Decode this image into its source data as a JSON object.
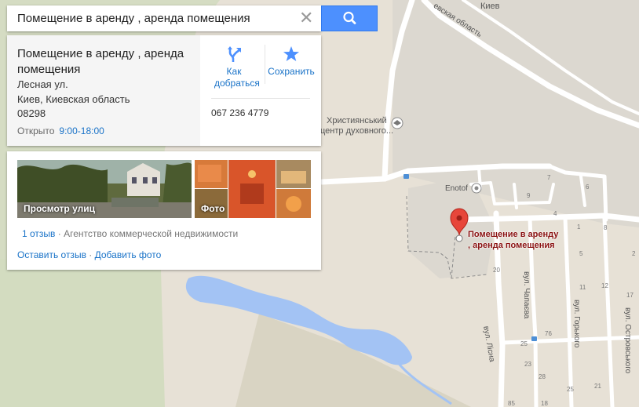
{
  "search": {
    "query": "Помещение в аренду , аренда помещения"
  },
  "place": {
    "name": "Помещение в аренду , аренда помещения",
    "street": "Лесная ул.",
    "city": "Киев, Киевская область",
    "postcode": "08298",
    "status": "Открыто",
    "hours": "9:00-18:00",
    "phone": "067 236 4779"
  },
  "actions": {
    "directions": "Как добраться",
    "save": "Сохранить"
  },
  "photos": {
    "street_view": "Просмотр улиц",
    "photo": "Фото"
  },
  "reviews": {
    "count": "1 отзыв",
    "category": "· Агентство коммерческой недвижимости"
  },
  "links": {
    "write_review": "Оставить отзыв",
    "separator": "·",
    "add_photo": "Добавить фото"
  },
  "map": {
    "region_label": "евская область",
    "city_label": "Киев",
    "poi_line1": "Християнський",
    "poi_line2": "центр духовного...",
    "enotof": "Enotof",
    "pin_label_1": "Помещение в аренду",
    "pin_label_2": ", аренда помещения",
    "streets": {
      "chapaeva": "вул. Чапаєва",
      "gorkogo": "вул. Горького",
      "ostrovskogo": "вул. Островського",
      "lisna": "вул. Лісна"
    },
    "house_numbers": [
      "7",
      "6",
      "9",
      "4",
      "1",
      "5",
      "8",
      "2",
      "20",
      "12",
      "11",
      "17",
      "76",
      "25",
      "23",
      "28",
      "21",
      "25",
      "85",
      "18"
    ]
  },
  "colors": {
    "accent": "#4d90fe",
    "link": "#1a73c8",
    "pin": "#e7463a",
    "water": "#a3c3f4",
    "park": "#cadfaa",
    "road": "#ffffff"
  }
}
